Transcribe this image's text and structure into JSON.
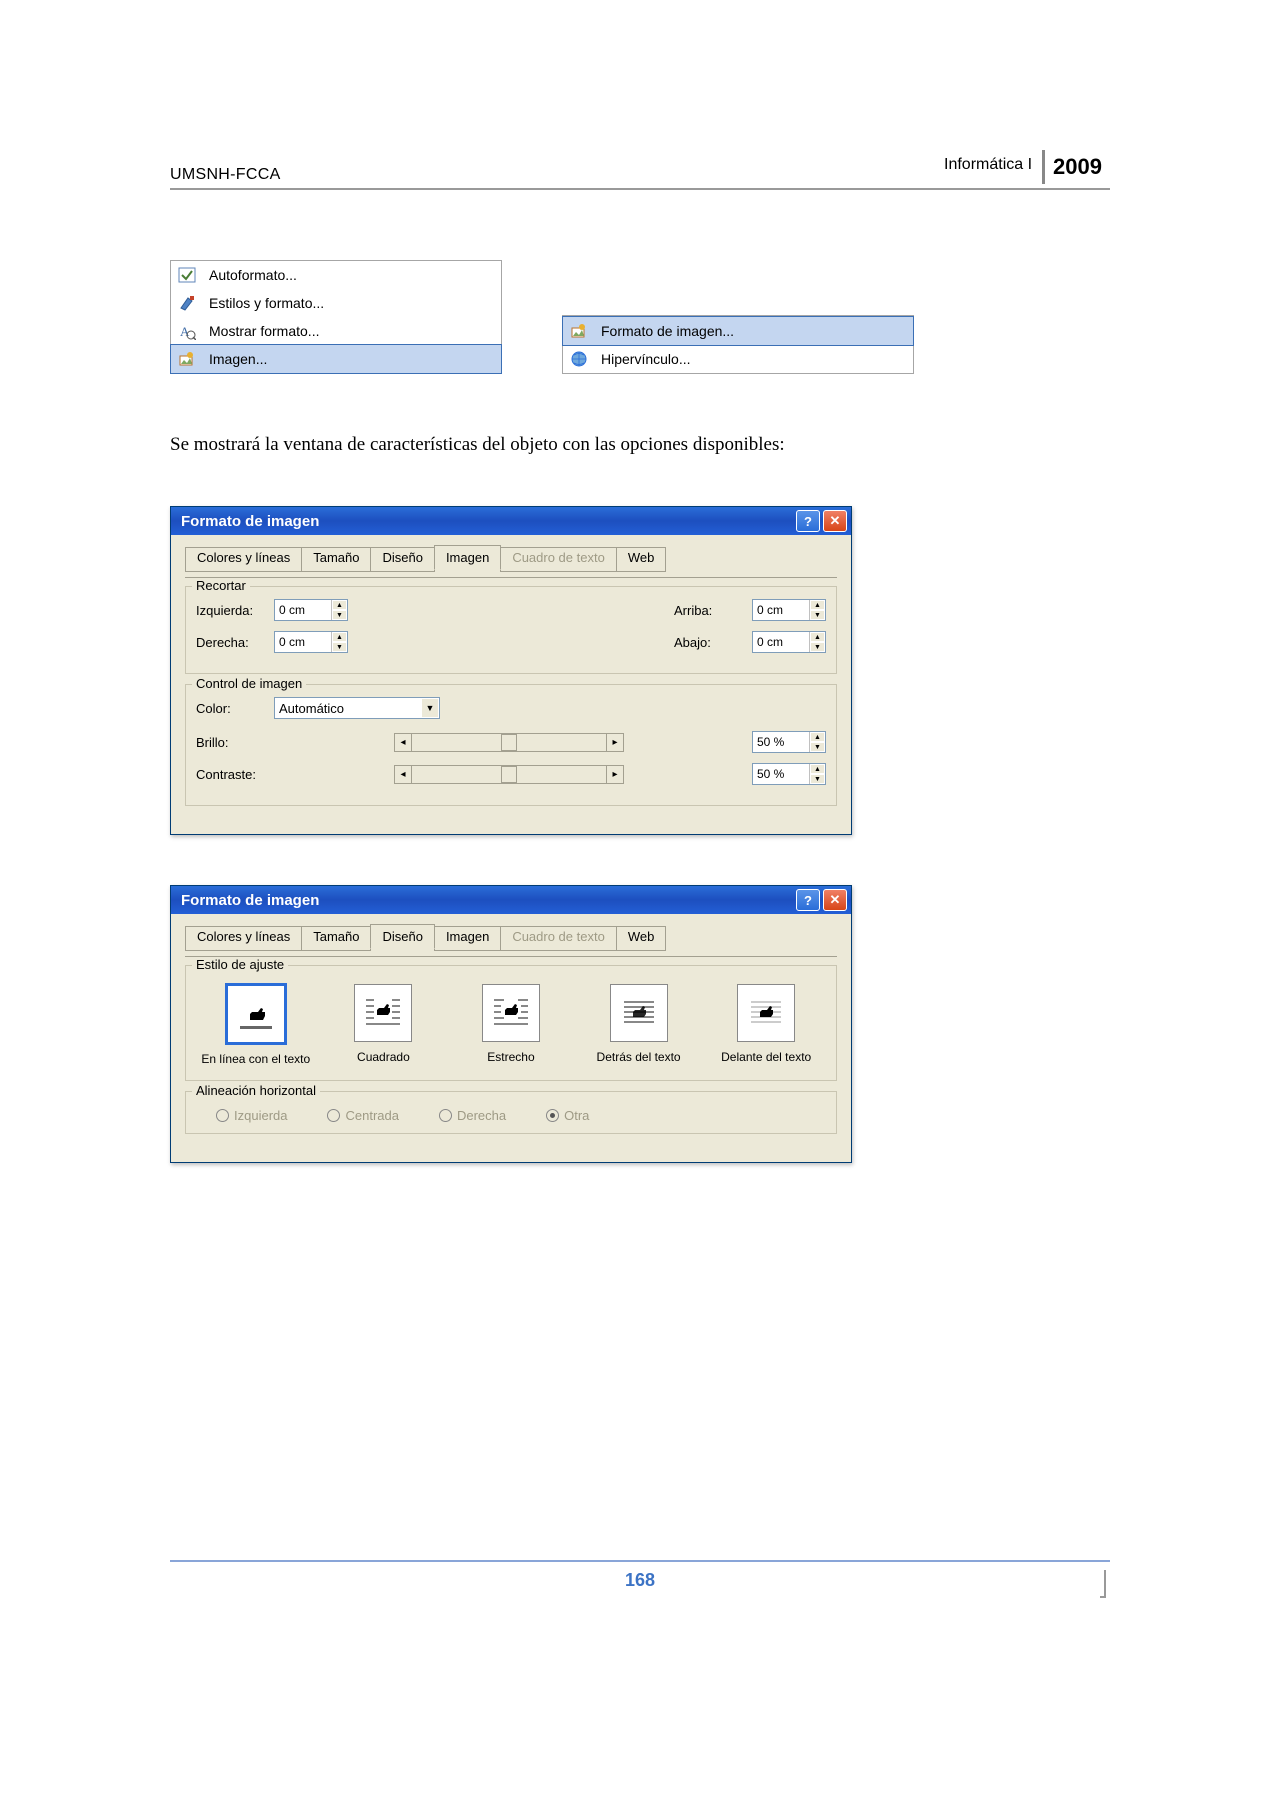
{
  "header": {
    "left": "UMSNH-FCCA",
    "course": "Informática I",
    "year": "2009"
  },
  "menu_left": {
    "items": [
      {
        "label": "Autoformato...",
        "icon": "autoformat",
        "selected": false
      },
      {
        "label": "Estilos y formato...",
        "icon": "styles",
        "selected": false
      },
      {
        "label": "Mostrar formato...",
        "icon": "show-format",
        "selected": false
      },
      {
        "label": "Imagen...",
        "icon": "image-format",
        "selected": true
      }
    ]
  },
  "menu_right": {
    "items": [
      {
        "label": "Formato de imagen...",
        "icon": "image-format",
        "selected": true
      },
      {
        "label": "Hipervínculo...",
        "icon": "hyperlink",
        "selected": false
      }
    ]
  },
  "body_text": "Se mostrará la ventana de características del objeto con las opciones disponibles:",
  "dialog1": {
    "title": "Formato de imagen",
    "tabs": [
      "Colores y líneas",
      "Tamaño",
      "Diseño",
      "Imagen",
      "Cuadro de texto",
      "Web"
    ],
    "active_tab": "Imagen",
    "disabled_tab": "Cuadro de texto",
    "recortar": {
      "title": "Recortar",
      "izquierda": {
        "label": "Izquierda:",
        "value": "0 cm"
      },
      "derecha": {
        "label": "Derecha:",
        "value": "0 cm"
      },
      "arriba": {
        "label": "Arriba:",
        "value": "0 cm"
      },
      "abajo": {
        "label": "Abajo:",
        "value": "0 cm"
      }
    },
    "control": {
      "title": "Control de imagen",
      "color_label": "Color:",
      "color_value": "Automático",
      "brillo_label": "Brillo:",
      "brillo_value": "50 %",
      "contraste_label": "Contraste:",
      "contraste_value": "50 %"
    }
  },
  "dialog2": {
    "title": "Formato de imagen",
    "tabs": [
      "Colores y líneas",
      "Tamaño",
      "Diseño",
      "Imagen",
      "Cuadro de texto",
      "Web"
    ],
    "active_tab": "Diseño",
    "disabled_tab": "Cuadro de texto",
    "estilo": {
      "title": "Estilo de ajuste",
      "options": [
        {
          "label": "En línea con el texto",
          "selected": true,
          "kind": "inline"
        },
        {
          "label": "Cuadrado",
          "selected": false,
          "kind": "square"
        },
        {
          "label": "Estrecho",
          "selected": false,
          "kind": "tight"
        },
        {
          "label": "Detrás del texto",
          "selected": false,
          "kind": "behind"
        },
        {
          "label": "Delante del texto",
          "selected": false,
          "kind": "front"
        }
      ]
    },
    "align": {
      "title": "Alineación horizontal",
      "izquierda": "Izquierda",
      "centrada": "Centrada",
      "derecha": "Derecha",
      "otra": "Otra",
      "checked": "otra"
    }
  },
  "footer": {
    "page": "168"
  }
}
